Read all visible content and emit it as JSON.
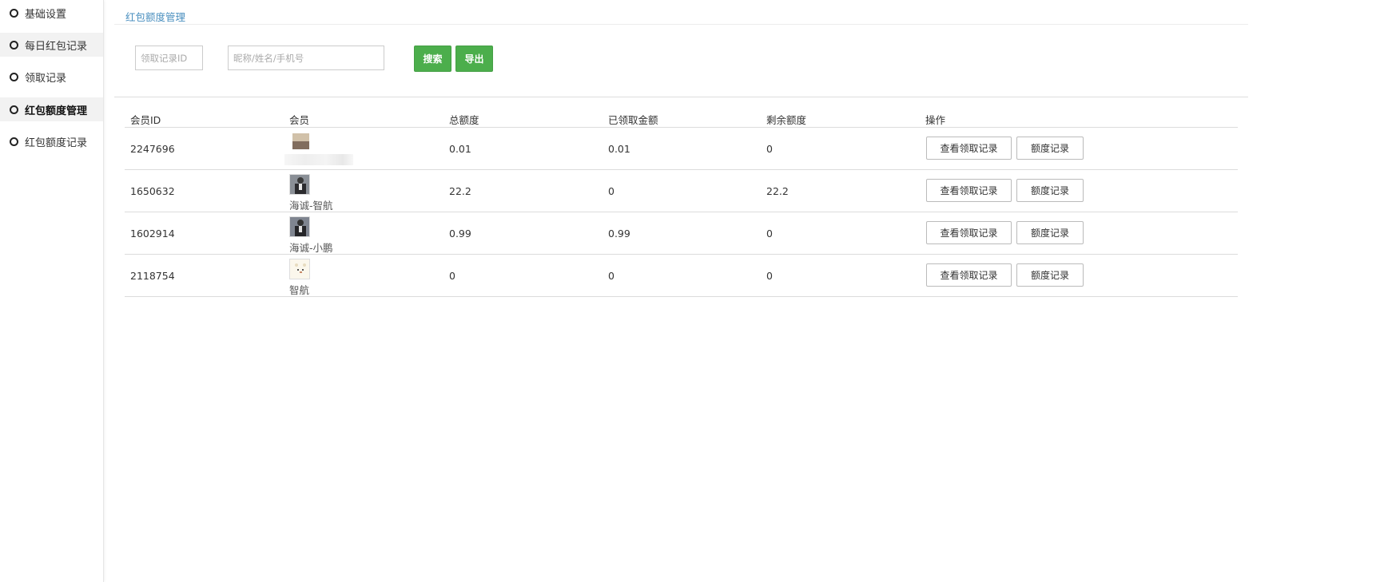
{
  "sidebar": {
    "items": [
      {
        "label": "基础设置"
      },
      {
        "label": "每日红包记录"
      },
      {
        "label": "领取记录"
      },
      {
        "label": "红包额度管理"
      },
      {
        "label": "红包额度记录"
      }
    ]
  },
  "page": {
    "title": "红包额度管理"
  },
  "filters": {
    "record_id_placeholder": "领取记录ID",
    "member_placeholder": "昵称/姓名/手机号",
    "search_label": "搜索",
    "export_label": "导出"
  },
  "table": {
    "headers": [
      "会员ID",
      "会员",
      "总额度",
      "已领取金额",
      "剩余额度",
      "操作"
    ],
    "rows": [
      {
        "id": "2247696",
        "member_name": "",
        "total": "0.01",
        "received": "0.01",
        "remaining": "0"
      },
      {
        "id": "1650632",
        "member_name": "海诚-智航",
        "total": "22.2",
        "received": "0",
        "remaining": "22.2"
      },
      {
        "id": "1602914",
        "member_name": "海诚-小鹏",
        "total": "0.99",
        "received": "0.99",
        "remaining": "0"
      },
      {
        "id": "2118754",
        "member_name": "智航",
        "total": "0",
        "received": "0",
        "remaining": "0"
      }
    ],
    "action_view_label": "查看领取记录",
    "action_quota_label": "额度记录"
  }
}
